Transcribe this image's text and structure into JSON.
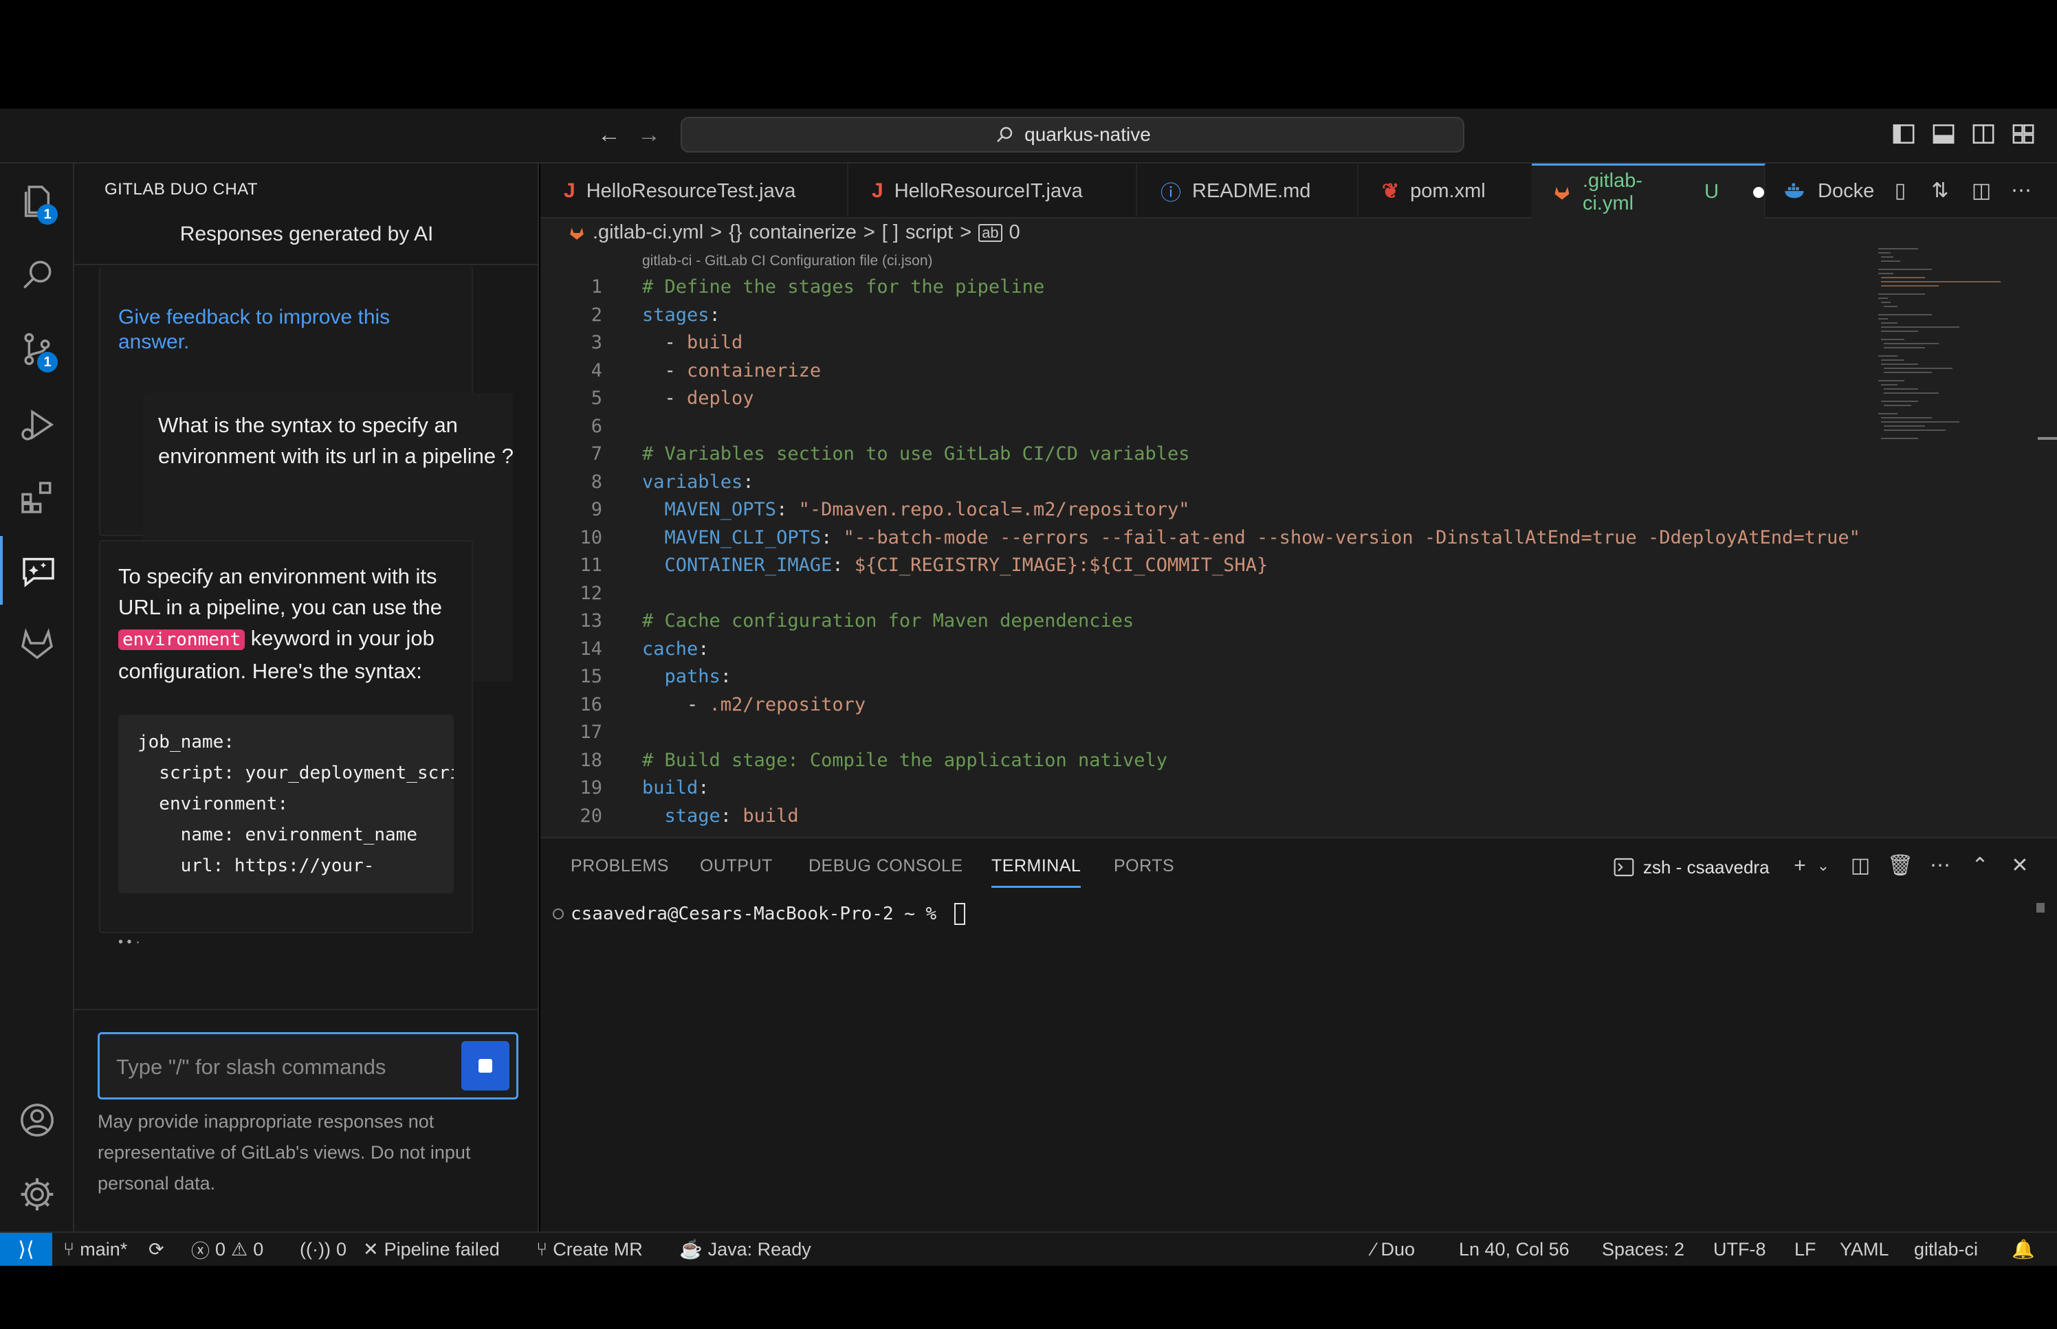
{
  "titlebar": {
    "search_text": "quarkus-native"
  },
  "activity": {
    "explorer_badge": "1",
    "scm_badge": "1"
  },
  "chat": {
    "title": "GITLAB DUO CHAT",
    "subtitle": "Responses generated by AI",
    "feedback_link": "Give feedback to improve this answer.",
    "user_message": "What is the syntax to specify an environment with its url in a pipeline ?",
    "answer_before": "To specify an environment with its URL in a pipeline, you can use the ",
    "answer_keyword": "environment",
    "answer_after": " keyword in your job configuration. Here's the syntax:",
    "code_block": "job_name:\n  script: your_deployment_script\n  environment:\n    name: environment_name\n    url: https://your-",
    "typing_indicator": "• • ·",
    "input_placeholder": "Type \"/\" for slash commands",
    "disclaimer": "May provide inappropriate responses not representative of GitLab's views. Do not input personal data."
  },
  "tabs": [
    {
      "label": "HelloResourceTest.java",
      "icon": "J",
      "color": "#f05545"
    },
    {
      "label": "HelloResourceIT.java",
      "icon": "J",
      "color": "#f05545"
    },
    {
      "label": "README.md",
      "icon": "ⓘ",
      "color": "#4c9df3"
    },
    {
      "label": "pom.xml",
      "icon": "❦",
      "color": "#e0443a"
    },
    {
      "label": ".gitlab-ci.yml",
      "status": "U",
      "icon": "gitlab",
      "color": "#e8743b"
    },
    {
      "label": "Docke",
      "icon": "docker",
      "color": "#3b8fd6"
    }
  ],
  "breadcrumb": {
    "file": ".gitlab-ci.yml",
    "sep": ">",
    "obj_icon": "{}",
    "obj": "containerize",
    "arr_icon": "[ ]",
    "arr": "script",
    "idx": "0"
  },
  "schema_hint": "gitlab-ci - GitLab CI Configuration file (ci.json)",
  "code_lines": [
    [
      {
        "t": "# Define the stages for the pipeline",
        "c": "c-com"
      }
    ],
    [
      {
        "t": "stages",
        "c": "c-key"
      },
      {
        "t": ":",
        "c": "c-pun"
      }
    ],
    [
      {
        "t": "  - ",
        "c": "c-pun"
      },
      {
        "t": "build",
        "c": "c-str"
      }
    ],
    [
      {
        "t": "  - ",
        "c": "c-pun"
      },
      {
        "t": "containerize",
        "c": "c-str"
      }
    ],
    [
      {
        "t": "  - ",
        "c": "c-pun"
      },
      {
        "t": "deploy",
        "c": "c-str"
      }
    ],
    [],
    [
      {
        "t": "# Variables section to use GitLab CI/CD variables",
        "c": "c-com"
      }
    ],
    [
      {
        "t": "variables",
        "c": "c-key"
      },
      {
        "t": ":",
        "c": "c-pun"
      }
    ],
    [
      {
        "t": "  MAVEN_OPTS",
        "c": "c-key"
      },
      {
        "t": ": ",
        "c": "c-pun"
      },
      {
        "t": "\"-Dmaven.repo.local=.m2/repository\"",
        "c": "c-str"
      }
    ],
    [
      {
        "t": "  MAVEN_CLI_OPTS",
        "c": "c-key"
      },
      {
        "t": ": ",
        "c": "c-pun"
      },
      {
        "t": "\"--batch-mode --errors --fail-at-end --show-version -DinstallAtEnd=true -DdeployAtEnd=true\"",
        "c": "c-str"
      }
    ],
    [
      {
        "t": "  CONTAINER_IMAGE",
        "c": "c-key"
      },
      {
        "t": ": ",
        "c": "c-pun"
      },
      {
        "t": "${CI_REGISTRY_IMAGE}:${CI_COMMIT_SHA}",
        "c": "c-str"
      }
    ],
    [],
    [
      {
        "t": "# Cache configuration for Maven dependencies",
        "c": "c-com"
      }
    ],
    [
      {
        "t": "cache",
        "c": "c-key"
      },
      {
        "t": ":",
        "c": "c-pun"
      }
    ],
    [
      {
        "t": "  paths",
        "c": "c-key"
      },
      {
        "t": ":",
        "c": "c-pun"
      }
    ],
    [
      {
        "t": "    - ",
        "c": "c-pun"
      },
      {
        "t": ".m2/repository",
        "c": "c-str"
      }
    ],
    [],
    [
      {
        "t": "# Build stage: Compile the application natively",
        "c": "c-com"
      }
    ],
    [
      {
        "t": "build",
        "c": "c-key"
      },
      {
        "t": ":",
        "c": "c-pun"
      }
    ],
    [
      {
        "t": "  stage",
        "c": "c-key"
      },
      {
        "t": ": ",
        "c": "c-pun"
      },
      {
        "t": "build",
        "c": "c-str"
      }
    ]
  ],
  "panel": {
    "tabs": [
      "PROBLEMS",
      "OUTPUT",
      "DEBUG CONSOLE",
      "TERMINAL",
      "PORTS"
    ],
    "active_tab": "TERMINAL",
    "shell_label": "zsh - csaavedra",
    "terminal_prompt": "csaavedra@Cesars-MacBook-Pro-2 ~ % "
  },
  "statusbar": {
    "branch": "main*",
    "errors": "0",
    "warnings": "0",
    "ports": "0",
    "pipeline": "Pipeline failed",
    "create_mr": "Create MR",
    "java": "Java: Ready",
    "duo": "Duo",
    "cursor_pos": "Ln 40, Col 56",
    "spaces": "Spaces: 2",
    "encoding": "UTF-8",
    "eol": "LF",
    "language": "YAML",
    "schema": "gitlab-ci"
  },
  "colors": {
    "accent": "#4c9df3",
    "keyword_highlight": "#e2366f",
    "modified_tab": "#73c991"
  }
}
